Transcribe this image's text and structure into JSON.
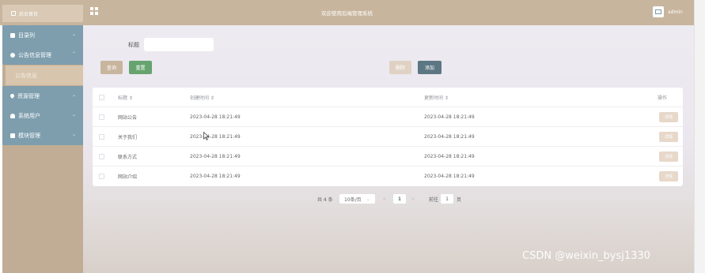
{
  "topbar": {
    "home_label": "后台首页",
    "system_title": "欢迎使用后端管理系统",
    "user_name": "admin"
  },
  "sidebar": {
    "items": [
      {
        "label": "目录列",
        "icon": "folder-icon",
        "chevron": "⌄"
      },
      {
        "label": "公告信息管理",
        "icon": "info-circle-icon",
        "chevron": "⌃"
      },
      {
        "label": "公告信息",
        "sub": true
      },
      {
        "label": "资源管理",
        "icon": "location-icon",
        "chevron": "⌄"
      },
      {
        "label": "系统用户",
        "icon": "user-icon",
        "chevron": "⌄"
      },
      {
        "label": "模块管理",
        "icon": "grid-icon",
        "chevron": "⌄"
      }
    ]
  },
  "search": {
    "label": "标题",
    "value": "",
    "placeholder": ""
  },
  "actions": {
    "query": "查询",
    "reset": "重置",
    "delete": "删除",
    "add": "添加"
  },
  "table": {
    "columns": [
      "标题 ⇕",
      "创建时间 ⇕",
      "更新时间 ⇕",
      "操作"
    ],
    "rows": [
      {
        "title": "网站公告",
        "created": "2023-04-28 18:21:49",
        "updated": "2023-04-28 18:21:49",
        "action": "详情"
      },
      {
        "title": "关于我们",
        "created": "2023-04-28 18:21:49",
        "updated": "2023-04-28 18:21:49",
        "action": "详情"
      },
      {
        "title": "联系方式",
        "created": "2023-04-28 18:21:49",
        "updated": "2023-04-28 18:21:49",
        "action": "详情"
      },
      {
        "title": "网站介绍",
        "created": "2023-04-28 18:21:49",
        "updated": "2023-04-28 18:21:49",
        "action": "详情"
      }
    ]
  },
  "pagination": {
    "total": "共 4 条",
    "page_size": "10条/页",
    "prev": "<",
    "current": "1",
    "next": ">",
    "goto_label": "前往",
    "goto_value": "1",
    "page_unit": "页"
  },
  "watermark": "CSDN @weixin_bysj1330",
  "colors": {
    "topbar": "#c8b59d",
    "menu": "#7e9eae",
    "submenu_active": "#d7c5ad",
    "query_button": "#c8b59d",
    "reset_button": "#67a36f",
    "delete_button": "#dfd2c4",
    "add_button": "#5d7683"
  }
}
